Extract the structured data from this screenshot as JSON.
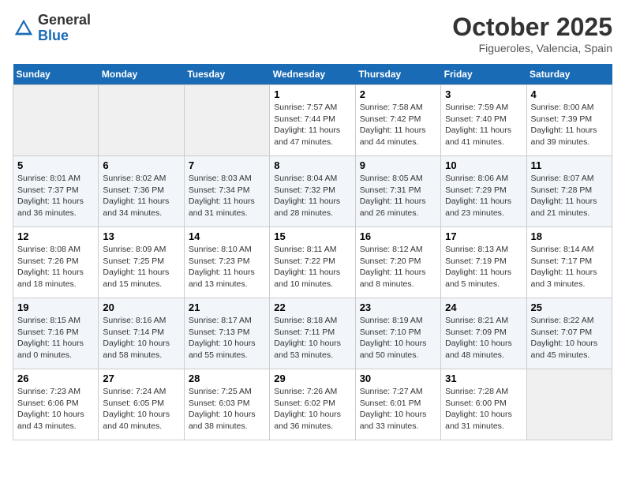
{
  "header": {
    "logo_general": "General",
    "logo_blue": "Blue",
    "month_title": "October 2025",
    "location": "Figueroles, Valencia, Spain"
  },
  "days_of_week": [
    "Sunday",
    "Monday",
    "Tuesday",
    "Wednesday",
    "Thursday",
    "Friday",
    "Saturday"
  ],
  "weeks": [
    [
      {
        "day": "",
        "empty": true
      },
      {
        "day": "",
        "empty": true
      },
      {
        "day": "",
        "empty": true
      },
      {
        "day": "1",
        "sunrise": "Sunrise: 7:57 AM",
        "sunset": "Sunset: 7:44 PM",
        "daylight": "Daylight: 11 hours and 47 minutes."
      },
      {
        "day": "2",
        "sunrise": "Sunrise: 7:58 AM",
        "sunset": "Sunset: 7:42 PM",
        "daylight": "Daylight: 11 hours and 44 minutes."
      },
      {
        "day": "3",
        "sunrise": "Sunrise: 7:59 AM",
        "sunset": "Sunset: 7:40 PM",
        "daylight": "Daylight: 11 hours and 41 minutes."
      },
      {
        "day": "4",
        "sunrise": "Sunrise: 8:00 AM",
        "sunset": "Sunset: 7:39 PM",
        "daylight": "Daylight: 11 hours and 39 minutes."
      }
    ],
    [
      {
        "day": "5",
        "sunrise": "Sunrise: 8:01 AM",
        "sunset": "Sunset: 7:37 PM",
        "daylight": "Daylight: 11 hours and 36 minutes."
      },
      {
        "day": "6",
        "sunrise": "Sunrise: 8:02 AM",
        "sunset": "Sunset: 7:36 PM",
        "daylight": "Daylight: 11 hours and 34 minutes."
      },
      {
        "day": "7",
        "sunrise": "Sunrise: 8:03 AM",
        "sunset": "Sunset: 7:34 PM",
        "daylight": "Daylight: 11 hours and 31 minutes."
      },
      {
        "day": "8",
        "sunrise": "Sunrise: 8:04 AM",
        "sunset": "Sunset: 7:32 PM",
        "daylight": "Daylight: 11 hours and 28 minutes."
      },
      {
        "day": "9",
        "sunrise": "Sunrise: 8:05 AM",
        "sunset": "Sunset: 7:31 PM",
        "daylight": "Daylight: 11 hours and 26 minutes."
      },
      {
        "day": "10",
        "sunrise": "Sunrise: 8:06 AM",
        "sunset": "Sunset: 7:29 PM",
        "daylight": "Daylight: 11 hours and 23 minutes."
      },
      {
        "day": "11",
        "sunrise": "Sunrise: 8:07 AM",
        "sunset": "Sunset: 7:28 PM",
        "daylight": "Daylight: 11 hours and 21 minutes."
      }
    ],
    [
      {
        "day": "12",
        "sunrise": "Sunrise: 8:08 AM",
        "sunset": "Sunset: 7:26 PM",
        "daylight": "Daylight: 11 hours and 18 minutes."
      },
      {
        "day": "13",
        "sunrise": "Sunrise: 8:09 AM",
        "sunset": "Sunset: 7:25 PM",
        "daylight": "Daylight: 11 hours and 15 minutes."
      },
      {
        "day": "14",
        "sunrise": "Sunrise: 8:10 AM",
        "sunset": "Sunset: 7:23 PM",
        "daylight": "Daylight: 11 hours and 13 minutes."
      },
      {
        "day": "15",
        "sunrise": "Sunrise: 8:11 AM",
        "sunset": "Sunset: 7:22 PM",
        "daylight": "Daylight: 11 hours and 10 minutes."
      },
      {
        "day": "16",
        "sunrise": "Sunrise: 8:12 AM",
        "sunset": "Sunset: 7:20 PM",
        "daylight": "Daylight: 11 hours and 8 minutes."
      },
      {
        "day": "17",
        "sunrise": "Sunrise: 8:13 AM",
        "sunset": "Sunset: 7:19 PM",
        "daylight": "Daylight: 11 hours and 5 minutes."
      },
      {
        "day": "18",
        "sunrise": "Sunrise: 8:14 AM",
        "sunset": "Sunset: 7:17 PM",
        "daylight": "Daylight: 11 hours and 3 minutes."
      }
    ],
    [
      {
        "day": "19",
        "sunrise": "Sunrise: 8:15 AM",
        "sunset": "Sunset: 7:16 PM",
        "daylight": "Daylight: 11 hours and 0 minutes."
      },
      {
        "day": "20",
        "sunrise": "Sunrise: 8:16 AM",
        "sunset": "Sunset: 7:14 PM",
        "daylight": "Daylight: 10 hours and 58 minutes."
      },
      {
        "day": "21",
        "sunrise": "Sunrise: 8:17 AM",
        "sunset": "Sunset: 7:13 PM",
        "daylight": "Daylight: 10 hours and 55 minutes."
      },
      {
        "day": "22",
        "sunrise": "Sunrise: 8:18 AM",
        "sunset": "Sunset: 7:11 PM",
        "daylight": "Daylight: 10 hours and 53 minutes."
      },
      {
        "day": "23",
        "sunrise": "Sunrise: 8:19 AM",
        "sunset": "Sunset: 7:10 PM",
        "daylight": "Daylight: 10 hours and 50 minutes."
      },
      {
        "day": "24",
        "sunrise": "Sunrise: 8:21 AM",
        "sunset": "Sunset: 7:09 PM",
        "daylight": "Daylight: 10 hours and 48 minutes."
      },
      {
        "day": "25",
        "sunrise": "Sunrise: 8:22 AM",
        "sunset": "Sunset: 7:07 PM",
        "daylight": "Daylight: 10 hours and 45 minutes."
      }
    ],
    [
      {
        "day": "26",
        "sunrise": "Sunrise: 7:23 AM",
        "sunset": "Sunset: 6:06 PM",
        "daylight": "Daylight: 10 hours and 43 minutes."
      },
      {
        "day": "27",
        "sunrise": "Sunrise: 7:24 AM",
        "sunset": "Sunset: 6:05 PM",
        "daylight": "Daylight: 10 hours and 40 minutes."
      },
      {
        "day": "28",
        "sunrise": "Sunrise: 7:25 AM",
        "sunset": "Sunset: 6:03 PM",
        "daylight": "Daylight: 10 hours and 38 minutes."
      },
      {
        "day": "29",
        "sunrise": "Sunrise: 7:26 AM",
        "sunset": "Sunset: 6:02 PM",
        "daylight": "Daylight: 10 hours and 36 minutes."
      },
      {
        "day": "30",
        "sunrise": "Sunrise: 7:27 AM",
        "sunset": "Sunset: 6:01 PM",
        "daylight": "Daylight: 10 hours and 33 minutes."
      },
      {
        "day": "31",
        "sunrise": "Sunrise: 7:28 AM",
        "sunset": "Sunset: 6:00 PM",
        "daylight": "Daylight: 10 hours and 31 minutes."
      },
      {
        "day": "",
        "empty": true
      }
    ]
  ]
}
